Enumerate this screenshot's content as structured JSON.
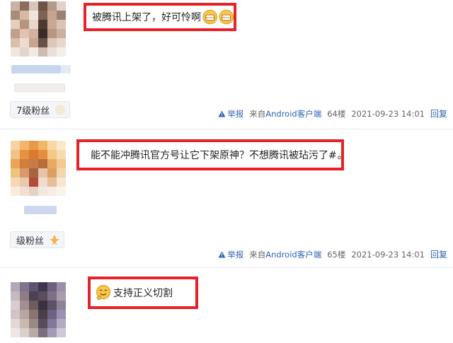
{
  "posts": [
    {
      "content": "被腾讯上架了，好可怜啊",
      "badge": "7级粉丝",
      "report": "举报",
      "source_prefix": "来自",
      "source_link": "Android客户端",
      "floor": "64楼",
      "datetime": "2021-09-23 14:01",
      "reply": "回复",
      "emojis": [
        "grin-icon",
        "grin-icon"
      ]
    },
    {
      "content": "能不能冲腾讯官方号让它下架原神？不想腾讯被玷污了#",
      "content_tail": "。",
      "badge": "级粉丝",
      "report": "举报",
      "source_prefix": "来自",
      "source_link": "Android客户端",
      "floor": "65楼",
      "datetime": "2021-09-23 14:01",
      "reply": "回复",
      "emojis": [
        "worried-face-icon"
      ]
    },
    {
      "content": "支持正义切割",
      "emojis": [
        "thumbs-up-face-icon"
      ]
    }
  ],
  "colors": {
    "highlight_border": "#e6212a",
    "link": "#2d64b3",
    "meta_text": "#666666",
    "divider": "#e4e6eb"
  }
}
